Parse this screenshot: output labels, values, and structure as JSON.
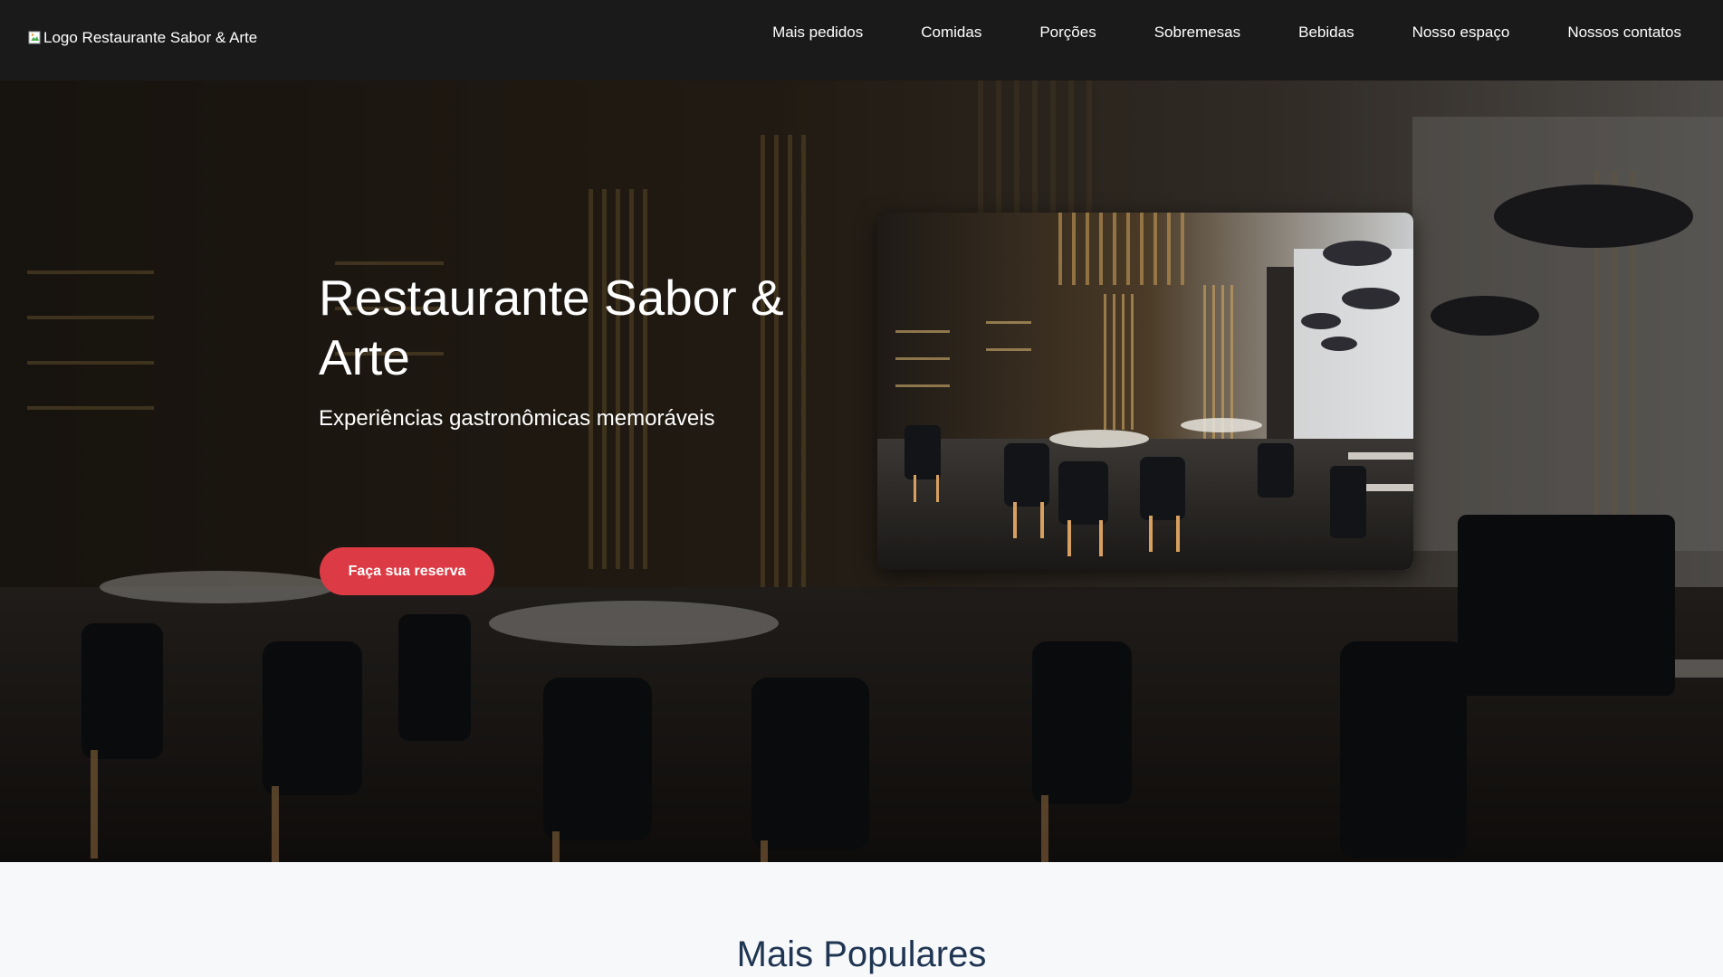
{
  "header": {
    "logo_alt": "Logo Restaurante Sabor & Arte",
    "nav": [
      {
        "label": "Mais pedidos"
      },
      {
        "label": "Comidas"
      },
      {
        "label": "Porções"
      },
      {
        "label": "Sobremesas"
      },
      {
        "label": "Bebidas"
      },
      {
        "label": "Nosso espaço"
      },
      {
        "label": "Nossos contatos"
      }
    ]
  },
  "hero": {
    "title": "Restaurante Sabor & Arte",
    "subtitle": "Experiências gastronômicas memoráveis",
    "cta_label": "Faça sua reserva"
  },
  "section": {
    "title": "Mais Populares"
  },
  "colors": {
    "header_bg": "#1a1a1a",
    "accent": "#dc3b45",
    "section_title": "#1f3552",
    "page_bg": "#f7f8fa"
  }
}
